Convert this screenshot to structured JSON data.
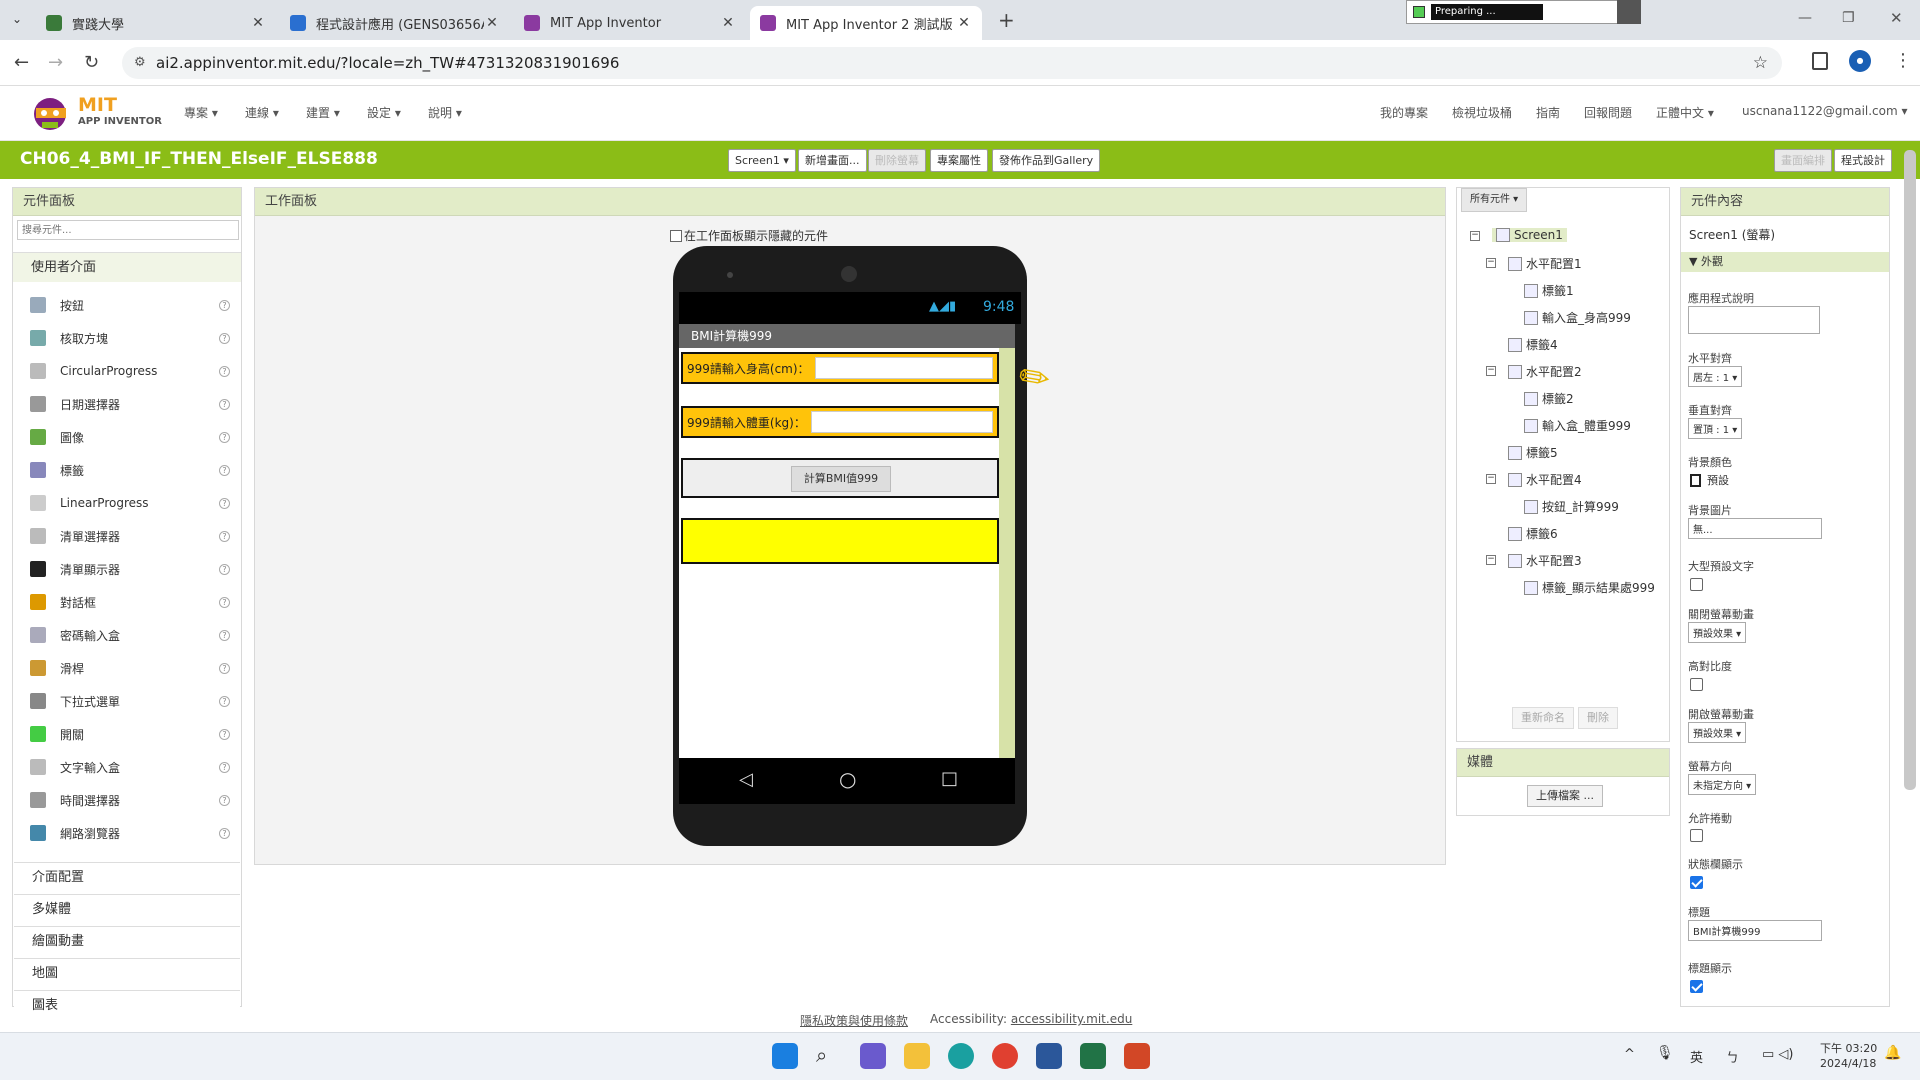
{
  "browser": {
    "tabs": [
      {
        "title": "實踐大學",
        "active": false,
        "color": "#3a7a3a"
      },
      {
        "title": "程式設計應用 (GENS03656A1",
        "active": false,
        "color": "#2a6fd0"
      },
      {
        "title": "MIT App Inventor",
        "active": false,
        "color": "#8b3aa0"
      },
      {
        "title": "MIT App Inventor 2 測試版",
        "active": true,
        "color": "#8b3aa0"
      }
    ],
    "preparing_text": "Preparing ...",
    "url": "ai2.appinventor.mit.edu/?locale=zh_TW#4731320831901696"
  },
  "app": {
    "logo_main": "MIT",
    "logo_sub": "APP INVENTOR",
    "menus": [
      "專案 ▾",
      "連線 ▾",
      "建置 ▾",
      "設定 ▾",
      "說明 ▾"
    ],
    "right_menus": [
      "我的專案",
      "檢視垃圾桶",
      "指南",
      "回報問題",
      "正體中文 ▾",
      "uscnana1122@gmail.com ▾"
    ],
    "project_title": "CH06_4_BMI_IF_THEN_ElseIF_ELSE888",
    "toolbar": {
      "screen_select": "Screen1 ▾",
      "add_screen": "新增畫面...",
      "remove_screen": "刪除螢幕",
      "project_props": "專案屬性",
      "publish": "發佈作品到Gallery",
      "designer": "畫面編排",
      "blocks": "程式設計"
    }
  },
  "palette": {
    "title": "元件面板",
    "search_placeholder": "搜尋元件...",
    "category_open": "使用者介面",
    "items": [
      {
        "label": "按鈕",
        "color": "#9ab"
      },
      {
        "label": "核取方塊",
        "color": "#7aa"
      },
      {
        "label": "CircularProgress",
        "color": "#bbb"
      },
      {
        "label": "日期選擇器",
        "color": "#999"
      },
      {
        "label": "圖像",
        "color": "#6a4"
      },
      {
        "label": "標籤",
        "color": "#88b"
      },
      {
        "label": "LinearProgress",
        "color": "#ccc"
      },
      {
        "label": "清單選擇器",
        "color": "#bbb"
      },
      {
        "label": "清單顯示器",
        "color": "#222"
      },
      {
        "label": "對話框",
        "color": "#d90"
      },
      {
        "label": "密碼輸入盒",
        "color": "#aab"
      },
      {
        "label": "滑桿",
        "color": "#c93"
      },
      {
        "label": "下拉式選單",
        "color": "#888"
      },
      {
        "label": "開關",
        "color": "#4c4"
      },
      {
        "label": "文字輸入盒",
        "color": "#bbb"
      },
      {
        "label": "時間選擇器",
        "color": "#999"
      },
      {
        "label": "網路瀏覽器",
        "color": "#48a"
      }
    ],
    "categories": [
      "介面配置",
      "多媒體",
      "繪圖動畫",
      "地圖",
      "圖表"
    ]
  },
  "viewer": {
    "title": "工作面板",
    "hidden_checkbox_label": "在工作面板顯示隱藏的元件",
    "phone": {
      "time": "9:48",
      "app_title": "BMI計算機999",
      "height_label": "999請輸入身高(cm)：",
      "weight_label": "999請輸入體重(kg)：",
      "button_label": "計算BMI值999"
    }
  },
  "components": {
    "dropdown": "所有元件 ▾",
    "tree": [
      {
        "label": "Screen1",
        "level": 0,
        "toggle": "⊟"
      },
      {
        "label": "水平配置1",
        "level": 1,
        "toggle": "⊟"
      },
      {
        "label": "標籤1",
        "level": 2,
        "toggle": ""
      },
      {
        "label": "輸入盒_身高999",
        "level": 2,
        "toggle": ""
      },
      {
        "label": "標籤4",
        "level": 1,
        "toggle": ""
      },
      {
        "label": "水平配置2",
        "level": 1,
        "toggle": "⊟"
      },
      {
        "label": "標籤2",
        "level": 2,
        "toggle": ""
      },
      {
        "label": "輸入盒_體重999",
        "level": 2,
        "toggle": ""
      },
      {
        "label": "標籤5",
        "level": 1,
        "toggle": ""
      },
      {
        "label": "水平配置4",
        "level": 1,
        "toggle": "⊟"
      },
      {
        "label": "按鈕_計算999",
        "level": 2,
        "toggle": ""
      },
      {
        "label": "標籤6",
        "level": 1,
        "toggle": ""
      },
      {
        "label": "水平配置3",
        "level": 1,
        "toggle": "⊟"
      },
      {
        "label": "標籤_顯示結果處999",
        "level": 2,
        "toggle": ""
      }
    ],
    "rename": "重新命名",
    "delete": "刪除",
    "media_title": "媒體",
    "upload": "上傳檔案 ..."
  },
  "properties": {
    "title": "元件內容",
    "component": "Screen1 (螢幕)",
    "section": "▼ 外觀",
    "about_label": "應用程式說明",
    "align_h_label": "水平對齊",
    "align_h_value": "居左 : 1 ▾",
    "align_v_label": "垂直對齊",
    "align_v_value": "置頂 : 1 ▾",
    "bg_color_label": "背景顏色",
    "bg_color_value": "預設",
    "bg_image_label": "背景圖片",
    "bg_image_value": "無...",
    "big_text_label": "大型預設文字",
    "close_anim_label": "關閉螢幕動畫",
    "close_anim_value": "預設效果 ▾",
    "contrast_label": "高對比度",
    "open_anim_label": "開啟螢幕動畫",
    "open_anim_value": "預設效果 ▾",
    "orientation_label": "螢幕方向",
    "orientation_value": "未指定方向 ▾",
    "scroll_label": "允許捲動",
    "statusbar_label": "狀態欄顯示",
    "title_label": "標題",
    "title_value": "BMI計算機999",
    "title_visible_label": "標題顯示"
  },
  "footer": {
    "privacy": "隱私政策與使用條款",
    "accessibility_label": "Accessibility:",
    "accessibility_link": "accessibility.mit.edu"
  },
  "taskbar": {
    "ime1": "英",
    "ime2": "ㄅ",
    "ampm": "下午 03:20",
    "date": "2024/4/18"
  }
}
